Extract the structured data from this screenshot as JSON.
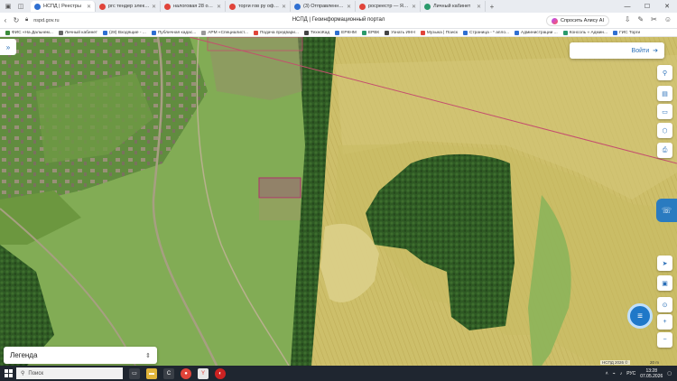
{
  "browser": {
    "tabs": [
      {
        "label": "НСПД | Реестры",
        "fav_color": "#2f6fd1",
        "active": true
      },
      {
        "label": "ргс тендер электронная...",
        "fav_color": "#e0443a",
        "active": false
      },
      {
        "label": "налоговая 28 официальн...",
        "fav_color": "#e0443a",
        "active": false
      },
      {
        "label": "торги гов ру официальн...",
        "fav_color": "#e0443a",
        "active": false
      },
      {
        "label": "(3) Отправленные - Почт...",
        "fav_color": "#2f6fd1",
        "active": false
      },
      {
        "label": "росреестр — Яндекс: на...",
        "fav_color": "#e0443a",
        "active": false
      },
      {
        "label": "Личный кабинет",
        "fav_color": "#2b9a6b",
        "active": false
      }
    ],
    "url": "nspd.gov.ru",
    "page_title": "НСПД | Геоинформационный портал",
    "alice_label": "Спросить Алису AI",
    "bookmarks": [
      {
        "label": "ФИС «На Дальнем...",
        "color": "#3a8b3a"
      },
      {
        "label": "Личный кабинет",
        "color": "#666"
      },
      {
        "label": "(28) Входящие - ...",
        "color": "#2f6fd1"
      },
      {
        "label": "Публичная кадас...",
        "color": "#2f6fd1"
      },
      {
        "label": "АРМ «Специалист...",
        "color": "#999"
      },
      {
        "label": "Подача предвари...",
        "color": "#e0443a"
      },
      {
        "label": "ТехноКад",
        "color": "#444"
      },
      {
        "label": "ЕРКНМ",
        "color": "#2f6fd1"
      },
      {
        "label": "ЕРВК",
        "color": "#2b9a6b"
      },
      {
        "label": "Узнать ИНН",
        "color": "#444"
      },
      {
        "label": "Музыка | Поиск",
        "color": "#e0443a"
      },
      {
        "label": "Страница - * апло...",
        "color": "#2f6fd1"
      },
      {
        "label": "Администрации ...",
        "color": "#2f6fd1"
      },
      {
        "label": "Консоль « Админ...",
        "color": "#2b9a6b"
      },
      {
        "label": "ГИС Торги",
        "color": "#2f6fd1"
      }
    ]
  },
  "map": {
    "login_label": "Войти",
    "legend_label": "Легенда",
    "attribution": "НСПД 2026 ©",
    "scale_label": "20 m"
  },
  "taskbar": {
    "search_placeholder": "Поиск",
    "lang": "РУС",
    "time": "13:28",
    "date": "07.05.2026"
  }
}
